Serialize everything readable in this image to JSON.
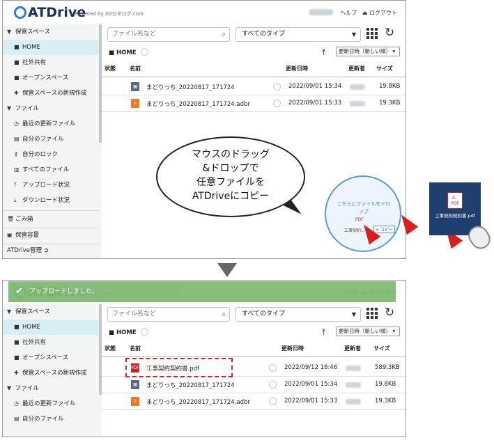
{
  "app": {
    "logo": "ATDrive",
    "powered_by": "Powered by 3Dカタログ.com",
    "help": "ヘルプ",
    "logout": "ログアウト"
  },
  "sidebar1": {
    "items": [
      {
        "label": "保管スペース",
        "icon": "triangle-down"
      },
      {
        "label": "HOME",
        "icon": "folder"
      },
      {
        "label": "社外共有",
        "icon": "folder"
      },
      {
        "label": "オープンスペース",
        "icon": "folder"
      },
      {
        "label": "保管スペースの新規作成",
        "icon": "plus"
      },
      {
        "label": "ファイル",
        "icon": "triangle-down"
      },
      {
        "label": "最近の更新ファイル",
        "icon": "clock"
      },
      {
        "label": "自分のファイル",
        "icon": "file"
      },
      {
        "label": "自分のロック",
        "icon": "key"
      },
      {
        "label": "すべてのファイル",
        "icon": "files"
      },
      {
        "label": "アップロード状況",
        "icon": "upload"
      },
      {
        "label": "ダウンロード状況",
        "icon": "download"
      },
      {
        "label": "ごみ箱",
        "icon": "trash"
      },
      {
        "label": "保管容量",
        "icon": "storage"
      },
      {
        "label": "ATDrive管理",
        "icon": "chevron-circle"
      }
    ]
  },
  "toolbar": {
    "search_placeholder": "ファイル名など",
    "type_filter": "すべてのタイプ",
    "breadcrumb": "HOME",
    "sort": "更新日時（新しい順）"
  },
  "table": {
    "headers": [
      "状態",
      "名前",
      "更新日時",
      "更新者",
      "サイズ"
    ]
  },
  "files_before": [
    {
      "name": "まどりっち_20220817_171724",
      "date": "2022/09/01 15:34",
      "size": "19.8KB",
      "type": "doc"
    },
    {
      "name": "まどりっち_20220817_171724.adbr",
      "date": "2022/09/01 15:33",
      "size": "19.3KB",
      "type": "adbr"
    }
  ],
  "files_after": [
    {
      "name": "工事契約契約書.pdf",
      "date": "2022/09/12 16:46",
      "size": "589.3KB",
      "type": "pdf"
    },
    {
      "name": "まどりっち_20220817_171724",
      "date": "2022/09/01 15:34",
      "size": "19.8KB",
      "type": "doc"
    },
    {
      "name": "まどりっち_20220817_171724.adbr",
      "date": "2022/09/01 15:33",
      "size": "19.3KB",
      "type": "adbr"
    }
  ],
  "sidebar2": {
    "items": [
      {
        "label": "保管スペース"
      },
      {
        "label": "HOME"
      },
      {
        "label": "社外共有"
      },
      {
        "label": "オープンスペース"
      },
      {
        "label": "保管スペースの新規作成"
      },
      {
        "label": "ファイル"
      },
      {
        "label": "最近の更新ファイル"
      },
      {
        "label": "自分のファイル"
      }
    ]
  },
  "dropzone": {
    "text": "こちらにファイルをドロップ",
    "file_label": "PDF",
    "name_label": "工事契約...",
    "copy_label": "+ コピー"
  },
  "callout": {
    "line1": "マウスのドラッグ",
    "line2": "&ドロップで",
    "line3": "任意ファイルを",
    "line4": "ATDriveにコピー"
  },
  "desktop_file": {
    "icon_label": "PDF",
    "name": "工事契約契約書.pdf"
  },
  "toast": {
    "message": "アップロードしました。"
  },
  "colors": {
    "accent": "#2f7fd1",
    "selected": "#d6eef4",
    "toast": "#7fb971",
    "pdf_red": "#c1272d",
    "adbr_orange": "#f07a22",
    "arrow_red": "#d91e1e"
  }
}
